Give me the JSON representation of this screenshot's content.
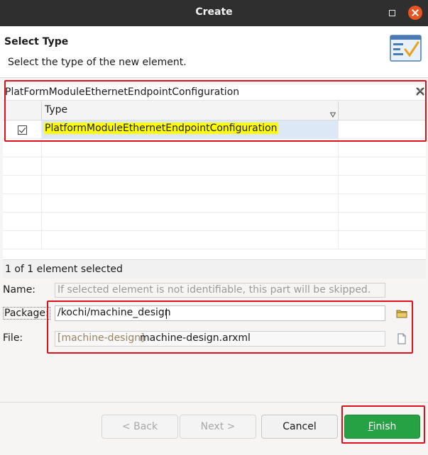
{
  "window": {
    "title": "Create"
  },
  "header": {
    "title": "Select Type",
    "description": "Select the type of the new element."
  },
  "filter": {
    "value": "PlatFormModuleEthernetEndpointConfiguration"
  },
  "table": {
    "column_header": "Type",
    "rows": [
      {
        "checked": true,
        "type": "PlatformModuleEthernetEndpointConfiguration"
      }
    ],
    "status": "1 of 1 element selected"
  },
  "form": {
    "name_label": "Name:",
    "name_placeholder": "If selected element is not identifiable, this part will be skipped.",
    "package_label": "Package:",
    "package_value": "/kochi/machine_design",
    "file_label": "File:",
    "file_project": "[machine-design]",
    "file_name": "machine-design.arxml"
  },
  "buttons": {
    "back": "< Back",
    "next": "Next >",
    "cancel": "Cancel",
    "finish_accel": "F",
    "finish_rest": "inish"
  },
  "colors": {
    "highlight": "#ffff00",
    "annotation_red": "#e0101a",
    "finish_green": "#26a244"
  },
  "icons": [
    "wizard-banner-icon",
    "clear-filter-icon",
    "sort-filter-icon",
    "checkbox-checked-icon",
    "folder-icon",
    "file-icon",
    "window-close-icon",
    "window-maximize-icon"
  ]
}
